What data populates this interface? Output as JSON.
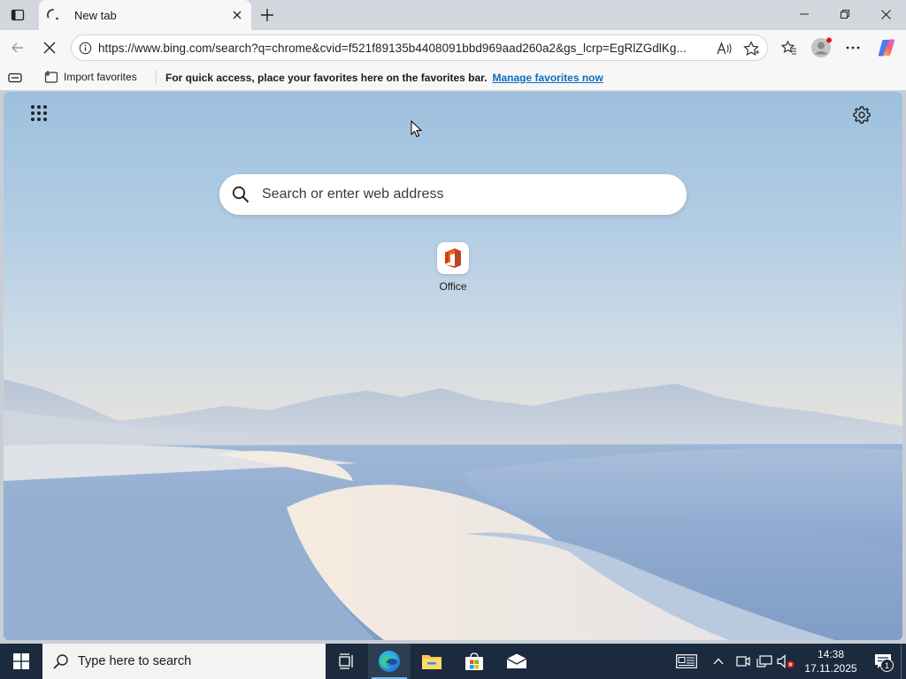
{
  "window": {
    "tab_title": "New tab",
    "controls": [
      "minimize-icon",
      "restore-icon",
      "close-icon"
    ]
  },
  "navbar": {
    "url": "https://www.bing.com/search?q=chrome&cvid=f521f89135b4408091bbd969aad260a2&gs_lcrp=EgRlZGdlKg...",
    "icons": [
      "back-arrow-icon",
      "stop-loading-icon",
      "site-info-icon",
      "read-aloud-icon",
      "favorite-star-icon",
      "favorites-icon",
      "profile-icon",
      "more-icon",
      "copilot-icon"
    ]
  },
  "favbar": {
    "import_label": "Import favorites",
    "message": "For quick access, place your favorites here on the favorites bar.",
    "link": "Manage favorites now"
  },
  "newtab": {
    "search_placeholder": "Search or enter web address",
    "tiles": [
      {
        "label": "Office",
        "icon": "office-icon"
      }
    ]
  },
  "taskbar": {
    "search_placeholder": "Type here to search",
    "apps": [
      "task-view-icon",
      "edge-icon",
      "file-explorer-icon",
      "store-icon",
      "mail-icon"
    ],
    "time": "14:38",
    "date": "17.11.2025",
    "notification_count": "1"
  },
  "colors": {
    "accent_link": "#0f6cbd",
    "taskbar": "#1b2a3c",
    "tab_strip": "#d3d6dc"
  }
}
